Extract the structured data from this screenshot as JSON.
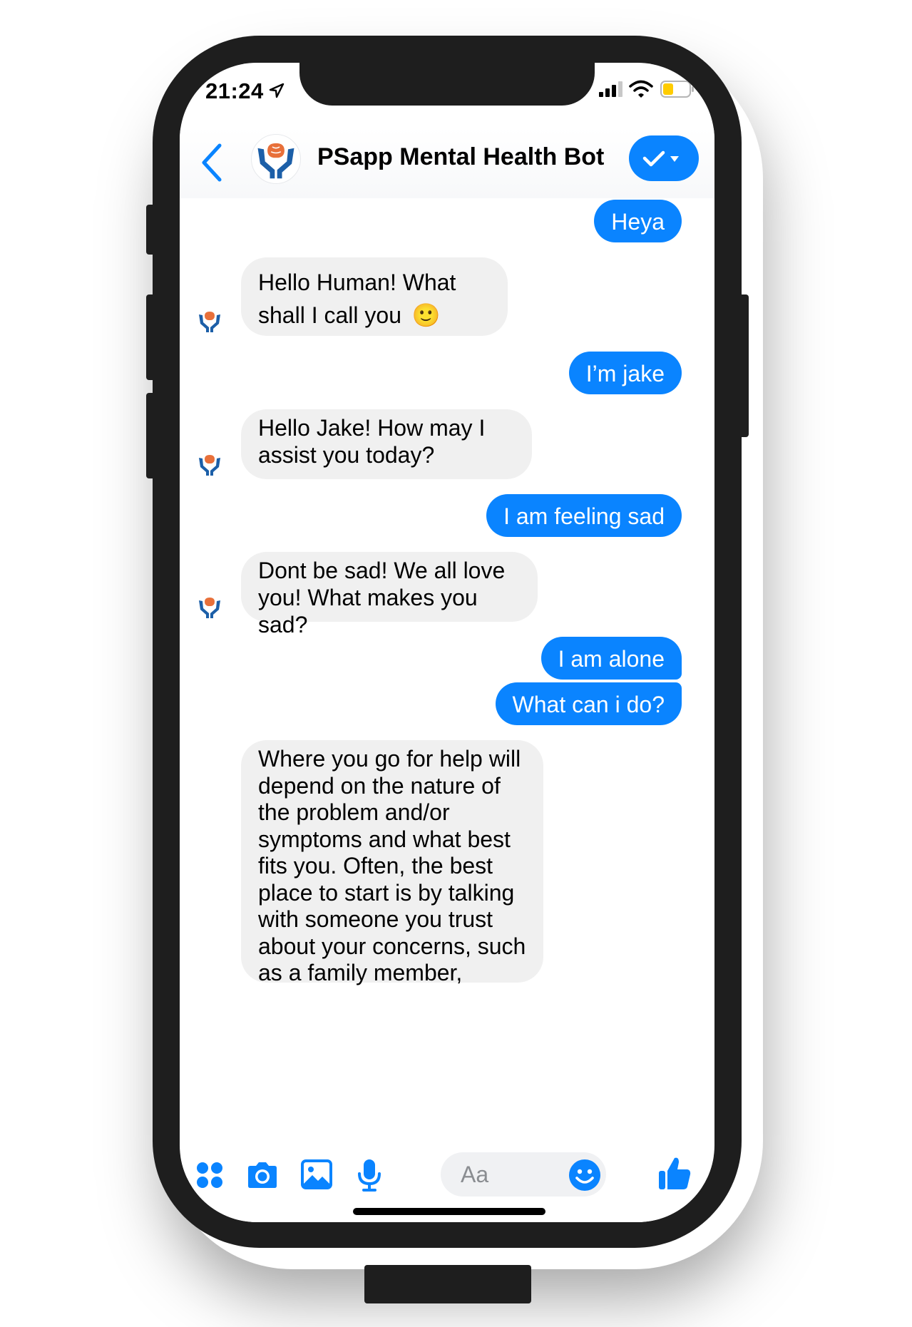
{
  "status_bar": {
    "time": "21:24",
    "icons": [
      "location-arrow-icon",
      "signal-icon",
      "wifi-icon",
      "battery-icon"
    ]
  },
  "header": {
    "back_icon": "chevron-left-icon",
    "avatar_icon": "brain-hands-logo",
    "title": "PSapp Mental Health Bot",
    "action_icon": "check-dropdown-icon"
  },
  "messages": [
    {
      "from": "user",
      "text": "Heya"
    },
    {
      "from": "bot",
      "text": "Hello Human! What shall I call you",
      "emoji": "🙂"
    },
    {
      "from": "user",
      "text": "I’m jake"
    },
    {
      "from": "bot",
      "text": "Hello Jake! How may I assist you today?"
    },
    {
      "from": "user",
      "text": "I am feeling sad"
    },
    {
      "from": "bot",
      "text": "Dont be sad! We all love you! What makes you sad?"
    },
    {
      "from": "user",
      "text": "I am alone"
    },
    {
      "from": "user",
      "text": "What can i do?"
    },
    {
      "from": "bot",
      "text": "Where you go for help will depend on the nature of the problem and/or symptoms and what best fits you. Often, the best place to start is by talking with someone you trust about your concerns, such as a family member,"
    }
  ],
  "composer": {
    "placeholder": "Aa",
    "tools": [
      "grid-dots-icon",
      "camera-icon",
      "image-icon",
      "microphone-icon",
      "emoji-icon",
      "thumbs-up-icon"
    ]
  },
  "colors": {
    "accent": "#0a84ff",
    "bot_bubble": "#f0f0f0",
    "frame": "#1e1e1e",
    "logo_orange": "#e8703a",
    "logo_blue": "#1c5fa8"
  }
}
